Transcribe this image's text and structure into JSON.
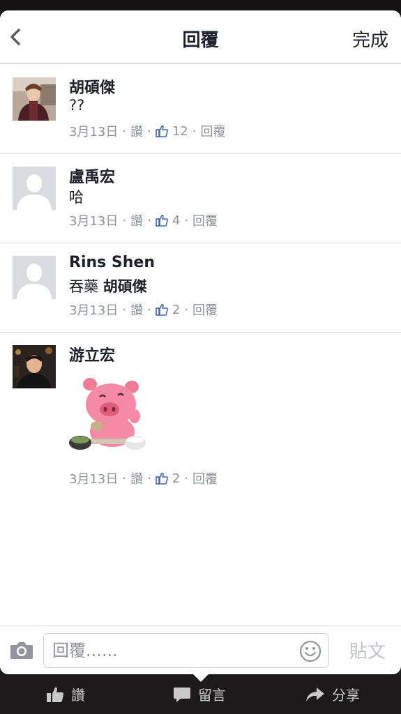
{
  "header": {
    "title": "回覆",
    "done_label": "完成"
  },
  "comments": [
    {
      "name": "胡碩傑",
      "text": "??",
      "date": "3月13日",
      "like_label": "讚",
      "like_count": "12",
      "reply_label": "回覆",
      "avatar": "photo"
    },
    {
      "name": "盧禹宏",
      "text": "哈",
      "date": "3月13日",
      "like_label": "讚",
      "like_count": "4",
      "reply_label": "回覆",
      "avatar": "default-silhouette"
    },
    {
      "name": "Rins Shen",
      "text_prefix": "吞藥",
      "tag": "胡碩傑",
      "date": "3月13日",
      "like_label": "讚",
      "like_count": "2",
      "reply_label": "回覆",
      "avatar": "default-silhouette"
    },
    {
      "name": "游立宏",
      "sticker": "pink-pig-eating-sticker",
      "date": "3月13日",
      "like_label": "讚",
      "like_count": "2",
      "reply_label": "回覆",
      "avatar": "photo"
    }
  ],
  "composer": {
    "placeholder": "回覆......",
    "post_label": "貼文"
  },
  "bottom_bar": {
    "like_label": "讚",
    "comment_label": "留言",
    "share_label": "分享"
  },
  "colors": {
    "text": "#1d2129",
    "meta": "#90949c",
    "like_blue": "#4267b2",
    "post_disabled": "#bec3c9"
  },
  "icons": [
    "back-chevron-icon",
    "thumbs-up-icon",
    "camera-icon",
    "smiley-icon",
    "comment-bubble-icon",
    "share-arrow-icon"
  ]
}
